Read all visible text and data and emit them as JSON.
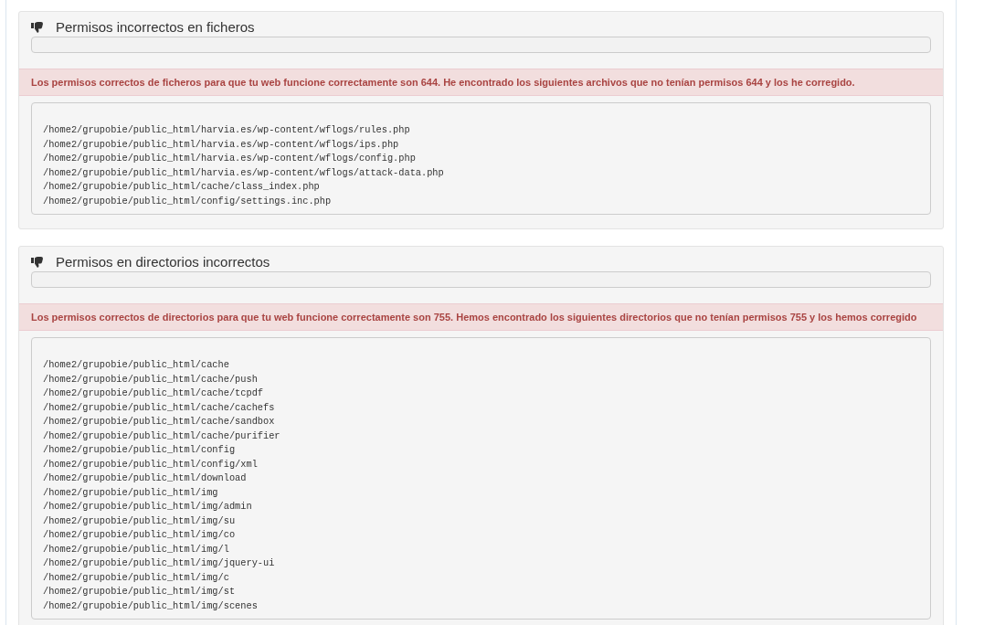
{
  "panels": [
    {
      "title": "Permisos incorrectos en ficheros",
      "message": "Los permisos correctos de ficheros para que tu web funcione correctamente son 644. He encontrado los siguientes archivos que no tenían permisos 644 y los he corregido.",
      "paths": [
        "/home2/grupobie/public_html/harvia.es/wp-content/wflogs/rules.php",
        "/home2/grupobie/public_html/harvia.es/wp-content/wflogs/ips.php",
        "/home2/grupobie/public_html/harvia.es/wp-content/wflogs/config.php",
        "/home2/grupobie/public_html/harvia.es/wp-content/wflogs/attack-data.php",
        "/home2/grupobie/public_html/cache/class_index.php",
        "/home2/grupobie/public_html/config/settings.inc.php"
      ]
    },
    {
      "title": "Permisos en directorios incorrectos",
      "message": "Los permisos correctos de directorios para que tu web funcione correctamente son 755. Hemos encontrado los siguientes directorios que no tenían permisos 755 y los hemos corregido",
      "paths": [
        "/home2/grupobie/public_html/cache",
        "/home2/grupobie/public_html/cache/push",
        "/home2/grupobie/public_html/cache/tcpdf",
        "/home2/grupobie/public_html/cache/cachefs",
        "/home2/grupobie/public_html/cache/sandbox",
        "/home2/grupobie/public_html/cache/purifier",
        "/home2/grupobie/public_html/config",
        "/home2/grupobie/public_html/config/xml",
        "/home2/grupobie/public_html/download",
        "/home2/grupobie/public_html/img",
        "/home2/grupobie/public_html/img/admin",
        "/home2/grupobie/public_html/img/su",
        "/home2/grupobie/public_html/img/co",
        "/home2/grupobie/public_html/img/l",
        "/home2/grupobie/public_html/img/jquery-ui",
        "/home2/grupobie/public_html/img/c",
        "/home2/grupobie/public_html/img/st",
        "/home2/grupobie/public_html/img/scenes"
      ]
    }
  ]
}
